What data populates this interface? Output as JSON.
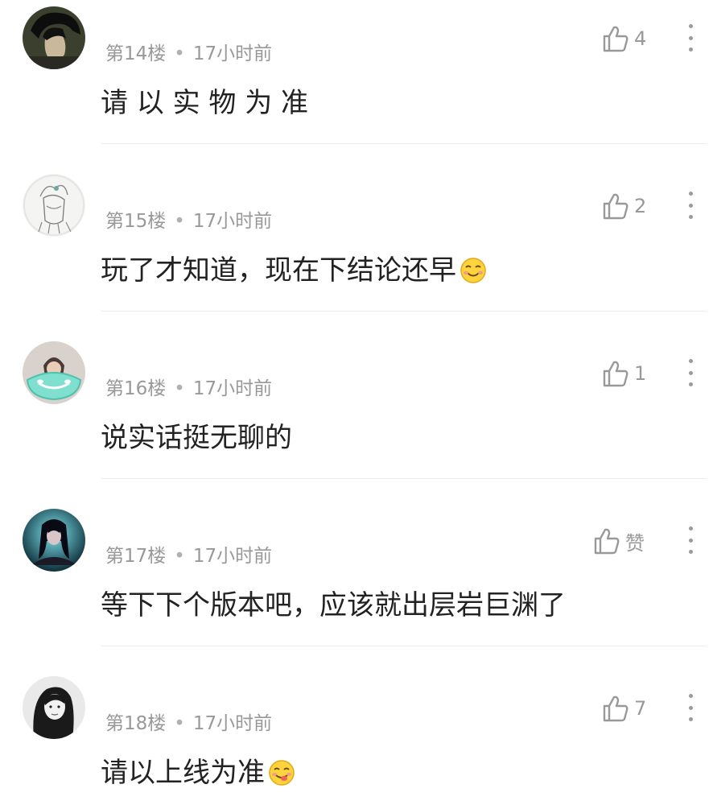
{
  "comments": [
    {
      "floor": "第14楼",
      "time": "17小时前",
      "likes": "4",
      "text": "请 以 实 物 为 准",
      "emoji": ""
    },
    {
      "floor": "第15楼",
      "time": "17小时前",
      "likes": "2",
      "text": "玩了才知道，现在下结论还早",
      "emoji": "smile-emoji"
    },
    {
      "floor": "第16楼",
      "time": "17小时前",
      "likes": "1",
      "text": "说实话挺无聊的",
      "emoji": ""
    },
    {
      "floor": "第17楼",
      "time": "17小时前",
      "likes": "赞",
      "text": "等下下个版本吧，应该就出层岩巨渊了",
      "emoji": ""
    },
    {
      "floor": "第18楼",
      "time": "17小时前",
      "likes": "7",
      "text": "请以上线为准",
      "emoji": "yummy-emoji"
    }
  ],
  "separator": "•",
  "icons": {
    "like": "thumbs-up-icon",
    "more": "more-vertical-icon"
  },
  "colors": {
    "meta": "#999999",
    "text": "#222222",
    "divider": "#ececec"
  }
}
